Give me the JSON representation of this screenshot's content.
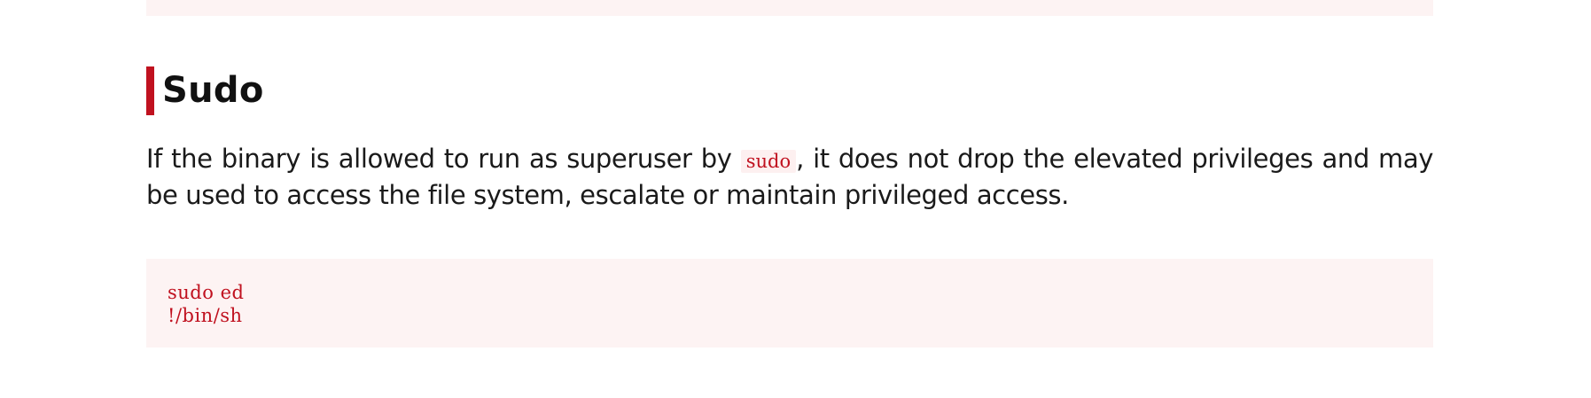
{
  "section": {
    "title": "Sudo",
    "description_before": "If the binary is allowed to run as superuser by ",
    "description_code": "sudo",
    "description_after": ", it does not drop the elevated privileges and may be used to access the file system, escalate or maintain privileged access."
  },
  "code": {
    "lines": [
      "sudo ed",
      "!/bin/sh"
    ]
  },
  "colors": {
    "accent": "#c0111f",
    "code_background": "#fdf3f3"
  }
}
